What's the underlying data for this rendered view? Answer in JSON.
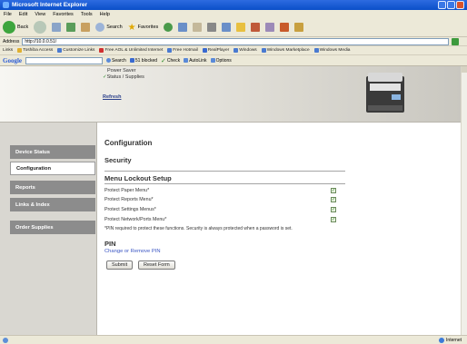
{
  "window": {
    "title": "Microsoft Internet Explorer"
  },
  "menu": [
    "File",
    "Edit",
    "View",
    "Favorites",
    "Tools",
    "Help"
  ],
  "toolbar": {
    "back_label": "Back",
    "search_label": "Search",
    "favorites_label": "Favorites"
  },
  "address": {
    "label": "Address",
    "value": "http://10.0.0.51/"
  },
  "links": {
    "label": "Links",
    "items": [
      "Toshiba Access",
      "Customize Links",
      "Free AOL & Unlimited Internet",
      "Free Hotmail",
      "RealPlayer",
      "Windows",
      "Windows Marketplace",
      "Windows Media"
    ]
  },
  "google": {
    "logo": "Google",
    "search_label": "Search",
    "blocked_label": "51 blocked",
    "check_label": "Check",
    "autolink_label": "AutoLink",
    "options_label": "Options"
  },
  "header": {
    "power_saver": "Power Saver",
    "status_supplies": "Status / Supplies",
    "refresh": "Refresh"
  },
  "nav": {
    "items": [
      {
        "label": "Device Status",
        "active": false
      },
      {
        "label": "Configuration",
        "active": true
      },
      {
        "label": "Reports",
        "active": false
      },
      {
        "label": "Links & Index",
        "active": false
      },
      {
        "label": "Order Supplies",
        "active": false
      }
    ]
  },
  "main": {
    "title": "Configuration",
    "section": "Security",
    "subsection": "Menu Lockout Setup",
    "options": [
      {
        "label": "Protect Paper Menu*",
        "checked": true
      },
      {
        "label": "Protect Reports Menu*",
        "checked": true
      },
      {
        "label": "Protect Settings Menus*",
        "checked": true
      },
      {
        "label": "Protect Network/Ports Menu*",
        "checked": true
      }
    ],
    "note": "*PIN required to protect these functions. Security is always protected when a password is set.",
    "pin_title": "PIN",
    "pin_link": "Change or Remove PIN",
    "submit_label": "Submit",
    "reset_label": "Reset Form"
  },
  "status": {
    "zone": "Internet"
  },
  "colors": {
    "titlebar": "#0a4fc9",
    "nav_inactive": "#8c8c8c",
    "link": "#3b56c4"
  }
}
